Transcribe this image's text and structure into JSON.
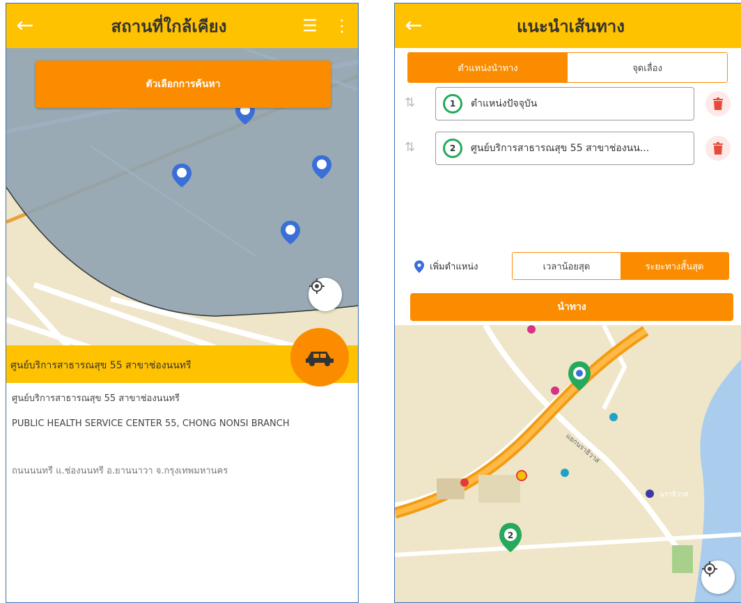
{
  "left": {
    "title": "สถานที่ใกล้เคียง",
    "back_icon": "arrow-left-icon",
    "list_icon": "list-icon",
    "more_icon": "more-vertical-icon",
    "search_options_label": "ตัวเลือกการค้นหา",
    "selected_place": "ศูนย์บริการสาธารณสุข 55 สาขาช่องนนทรี",
    "detail": {
      "name_th": "ศูนย์บริการสาธารณสุข 55 สาขาช่องนนทรี",
      "name_en": "PUBLIC HEALTH SERVICE CENTER 55, CHONG NONSI BRANCH",
      "address": "ถนนนนทรี แ.ช่องนนทรี อ.ยานนาวา จ.กรุงเทพมหานคร"
    },
    "colors": {
      "appbar": "#ffc200",
      "accent": "#fb8c00",
      "pin": "#3a6fd8",
      "radius": "#8fa3b3"
    }
  },
  "right": {
    "title": "แนะนำเส้นทาง",
    "tabs": [
      "ตำแหน่งนำทาง",
      "จุดเลื่อง"
    ],
    "stops": [
      {
        "num": "1",
        "label": "ตำแหน่งปัจจุบัน"
      },
      {
        "num": "2",
        "label": "ศูนย์บริการสาธารณสุข 55 สาขาช่องนน..."
      }
    ],
    "add_location": "เพิ่มตำแหน่ง",
    "route_options": [
      "เวลาน้อยสุด",
      "ระยะทางสั้นสุด"
    ],
    "navigate_label": "นำทาง",
    "map_marker_num": "2",
    "map_labels": [
      "แยกนราธิวาส",
      "นราธิวาส"
    ]
  }
}
